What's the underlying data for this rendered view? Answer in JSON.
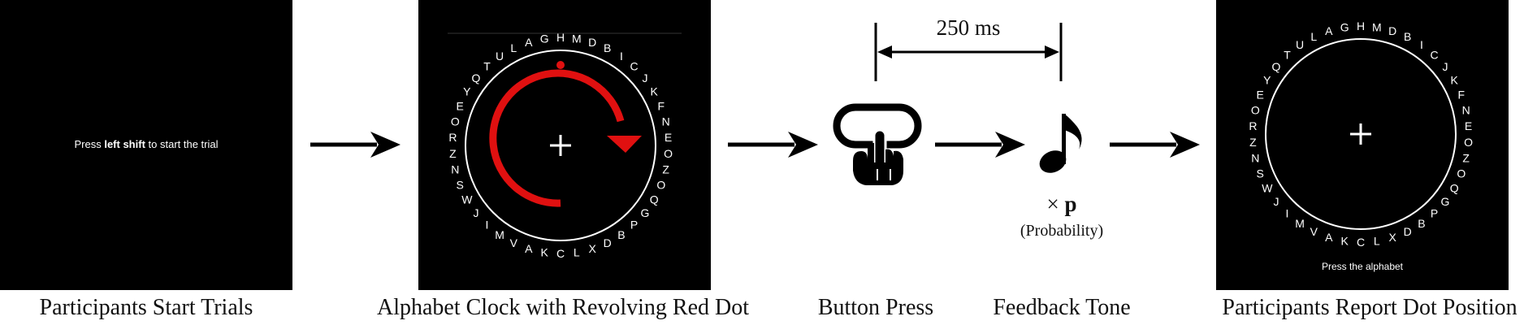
{
  "panel1": {
    "prefix": "Press ",
    "bold": "left shift",
    "suffix": " to start the trial"
  },
  "clock": {
    "letters": [
      "H",
      "M",
      "D",
      "B",
      "I",
      "C",
      "J",
      "K",
      "F",
      "N",
      "E",
      "O",
      "Z",
      "O",
      "Q",
      "G",
      "P",
      "B",
      "D",
      "X",
      "L",
      "C",
      "K",
      "A",
      "V",
      "M",
      "I",
      "J",
      "W",
      "S",
      "N",
      "Z",
      "R",
      "O",
      "E",
      "Y",
      "Q",
      "T",
      "U",
      "L",
      "A",
      "G"
    ]
  },
  "panel5": {
    "prompt": "Press the alphabet"
  },
  "timing": {
    "label": "250 ms"
  },
  "feedback": {
    "multiplier_symbol": "×",
    "multiplier_var": "p",
    "note": "(Probability)"
  },
  "captions": {
    "c1": "Participants Start Trials",
    "c2": "Alphabet Clock with Revolving Red Dot",
    "c3": "Button Press",
    "c4": "Feedback Tone",
    "c5": "Participants Report Dot Position"
  },
  "colors": {
    "dot": "#e01010",
    "arrow_red": "#e01010",
    "panel_bg": "#000000"
  },
  "icons": {
    "button": "hand-pressing-button-icon",
    "tone": "music-note-icon"
  }
}
